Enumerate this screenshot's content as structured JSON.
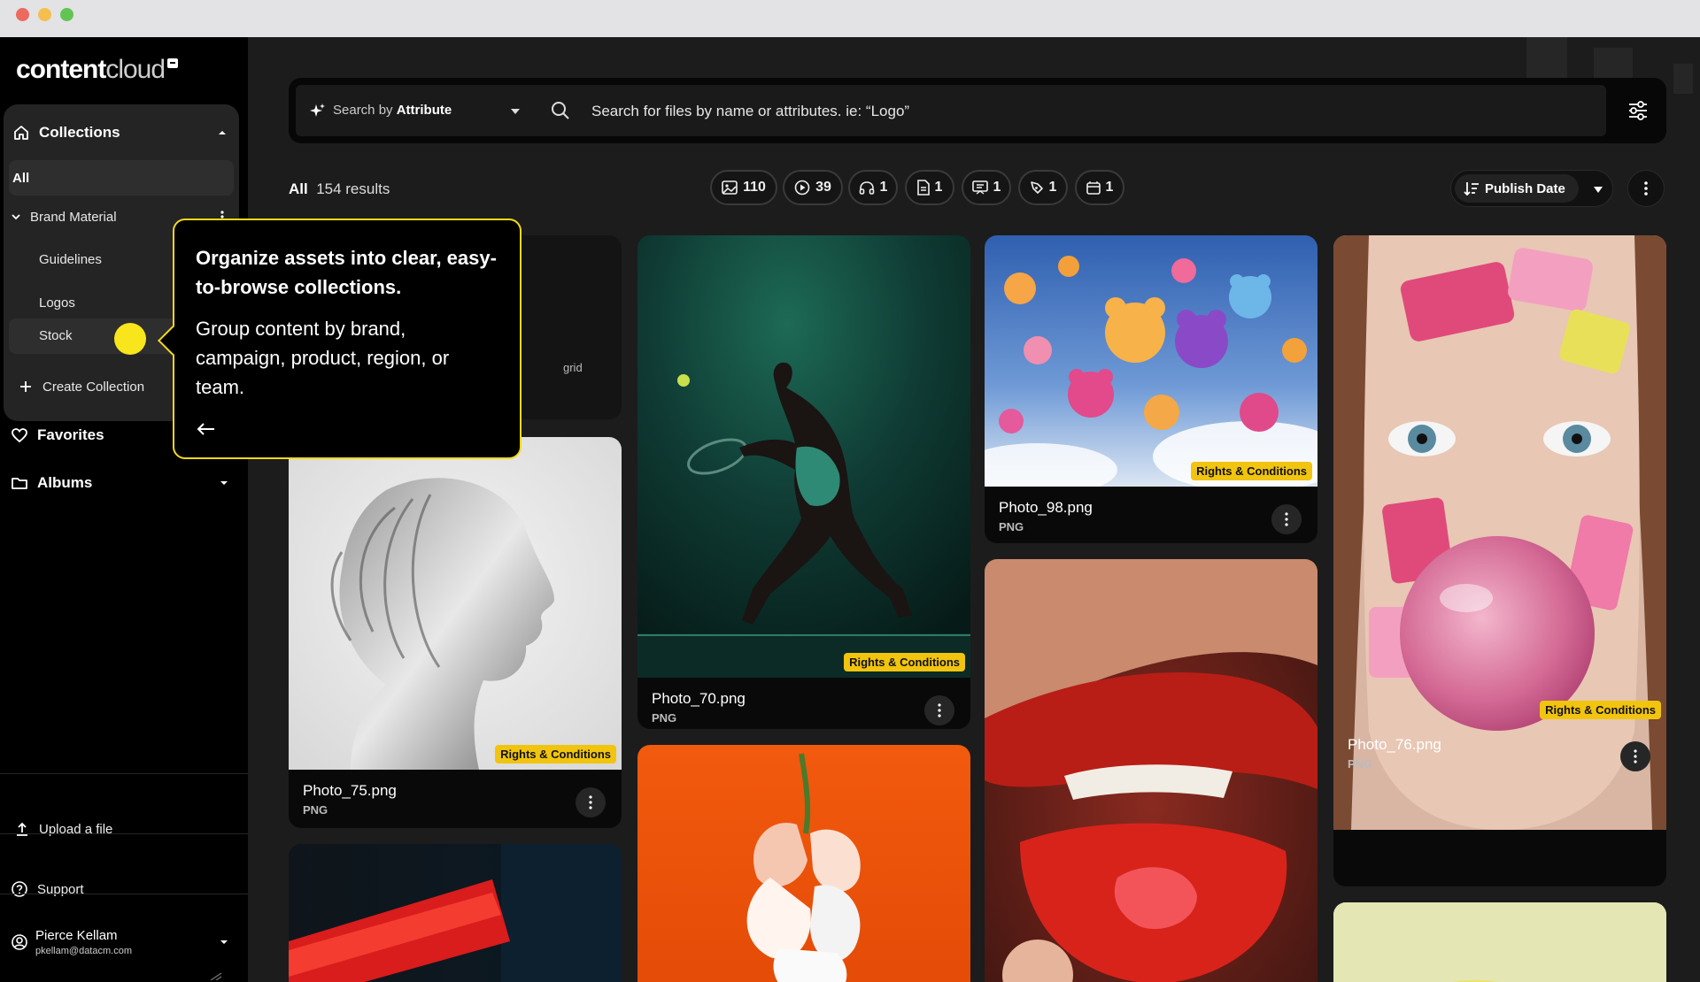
{
  "window": {
    "traffic_lights": [
      "#ed6a5e",
      "#f5bf4f",
      "#61c554"
    ]
  },
  "brand": {
    "logo_bold": "content",
    "logo_light": "cloud"
  },
  "sidebar": {
    "collections_label": "Collections",
    "items": {
      "all": "All",
      "brand_material": "Brand Material",
      "guidelines": "Guidelines",
      "logos": "Logos",
      "stock": "Stock",
      "create_collection": "Create Collection"
    },
    "favorites": "Favorites",
    "albums": "Albums",
    "upload": "Upload a file",
    "support": "Support",
    "user": {
      "name": "Pierce Kellam",
      "email": "pkellam@datacm.com"
    }
  },
  "search": {
    "mode_prefix": "Search by ",
    "mode_bold": "Attribute",
    "placeholder": "Search for files by name or attributes.  ie: “Logo”"
  },
  "results": {
    "filter_label": "All",
    "count_text": "154 results"
  },
  "chips": [
    {
      "icon": "image-icon",
      "count": "110"
    },
    {
      "icon": "video-icon",
      "count": "39"
    },
    {
      "icon": "audio-icon",
      "count": "1"
    },
    {
      "icon": "document-icon",
      "count": "1"
    },
    {
      "icon": "presentation-icon",
      "count": "1"
    },
    {
      "icon": "vector-icon",
      "count": "1"
    },
    {
      "icon": "template-icon",
      "count": "1"
    }
  ],
  "sort": {
    "label": "Publish Date"
  },
  "cards": {
    "partial": {
      "visible_text": "grid"
    },
    "photo75": {
      "name": "Photo_75.png",
      "type": "PNG",
      "badge": "Rights & Conditions"
    },
    "photo70": {
      "name": "Photo_70.png",
      "type": "PNG",
      "badge": "Rights & Conditions"
    },
    "photo98": {
      "name": "Photo_98.png",
      "type": "PNG",
      "badge": "Rights & Conditions"
    },
    "photo76": {
      "name": "Photo_76.png",
      "type": "PNG",
      "badge": "Rights & Conditions"
    }
  },
  "tooltip": {
    "title": "Organize assets into clear, easy-to-browse collections.",
    "body": "Group content by brand, campaign, product, region, or team."
  },
  "colors": {
    "accent_yellow": "#f3d91a",
    "badge_yellow": "#f1c40f"
  }
}
